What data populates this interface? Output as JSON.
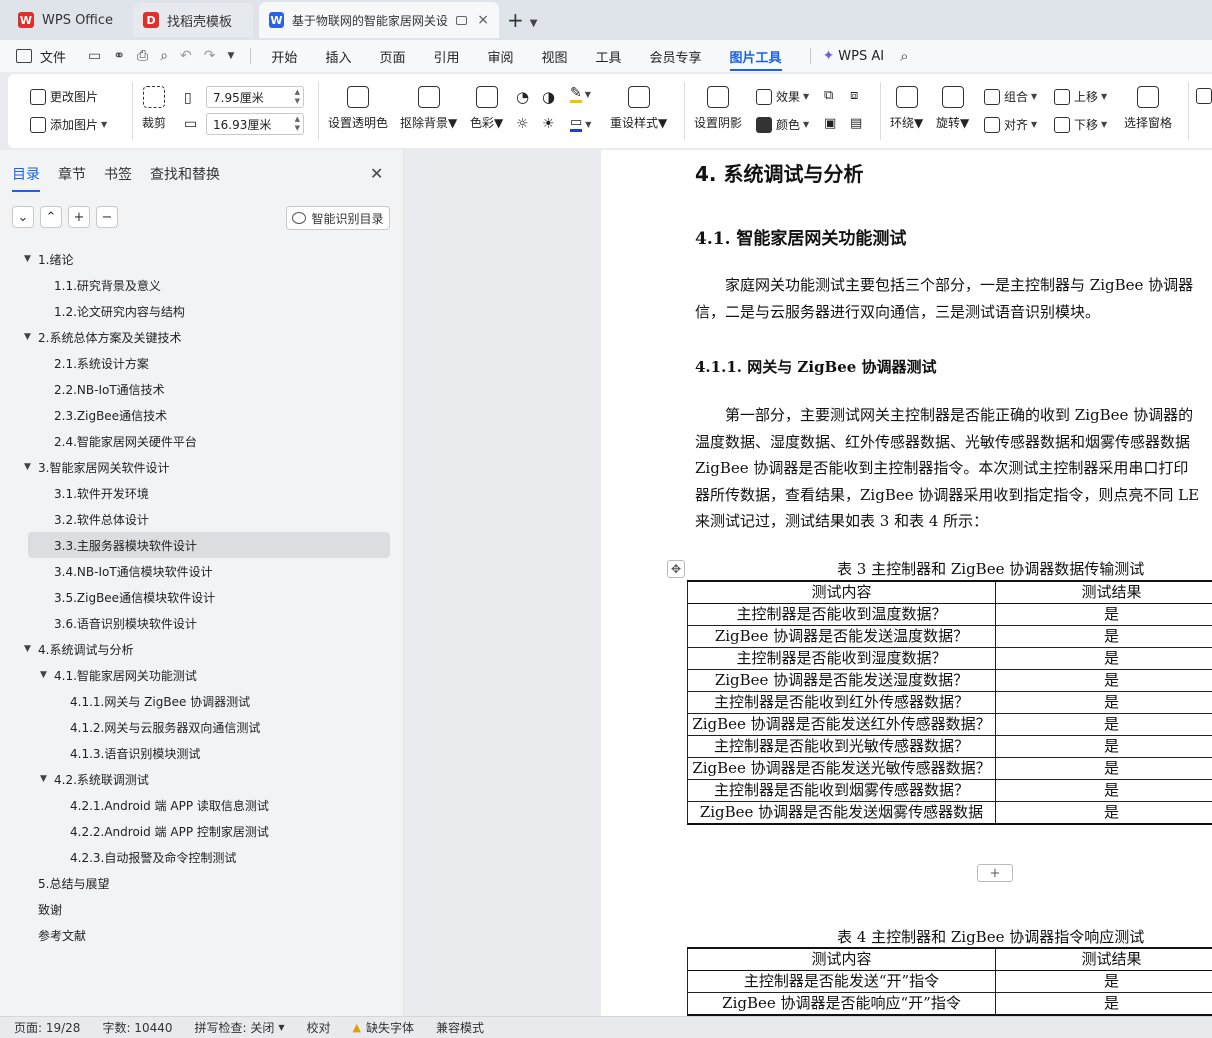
{
  "tabs": [
    {
      "label": "WPS Office",
      "icon": "wps-logo-icon",
      "color": "#e0302a"
    },
    {
      "label": "找稻壳模板",
      "icon": "docer-icon",
      "color": "#e0302a"
    },
    {
      "label": "基于物联网的智能家居网关设计",
      "icon": "writer-doc-icon",
      "color": "#2a62e8"
    }
  ],
  "menu": {
    "file": "文件",
    "items": [
      "开始",
      "插入",
      "页面",
      "引用",
      "审阅",
      "视图",
      "工具",
      "会员专享"
    ],
    "active": "图片工具",
    "ai": "WPS AI"
  },
  "ribbon": {
    "change_image": "更改图片",
    "add_image": "添加图片",
    "crop": "裁剪",
    "width": "7.95厘米",
    "height": "16.93厘米",
    "transparent": "设置透明色",
    "remove_bg": "抠除背景",
    "color": "色彩",
    "reset_style": "重设样式",
    "shadow": "设置阴影",
    "effect": "效果",
    "fill": "颜色",
    "wrap": "环绕",
    "rotate": "旋转",
    "group": "组合",
    "align": "对齐",
    "move_up": "上移",
    "move_down": "下移",
    "select_pane": "选择窗格"
  },
  "nav": {
    "tabs": [
      "目录",
      "章节",
      "书签",
      "查找和替换"
    ],
    "smart_btn": "智能识别目录",
    "toc": [
      {
        "label": "1.绪论",
        "level": 1,
        "expanded": true
      },
      {
        "label": "1.1.研究背景及意义",
        "level": 2
      },
      {
        "label": "1.2.论文研究内容与结构",
        "level": 2
      },
      {
        "label": "2.系统总体方案及关键技术",
        "level": 1,
        "expanded": true
      },
      {
        "label": "2.1.系统设计方案",
        "level": 2
      },
      {
        "label": "2.2.NB-IoT通信技术",
        "level": 2
      },
      {
        "label": "2.3.ZigBee通信技术",
        "level": 2
      },
      {
        "label": "2.4.智能家居网关硬件平台",
        "level": 2
      },
      {
        "label": "3.智能家居网关软件设计",
        "level": 1,
        "expanded": true
      },
      {
        "label": "3.1.软件开发环境",
        "level": 2
      },
      {
        "label": "3.2.软件总体设计",
        "level": 2
      },
      {
        "label": "3.3.主服务器模块软件设计",
        "level": 2,
        "selected": true
      },
      {
        "label": "3.4.NB-IoT通信模块软件设计",
        "level": 2
      },
      {
        "label": "3.5.ZigBee通信模块软件设计",
        "level": 2
      },
      {
        "label": "3.6.语音识别模块软件设计",
        "level": 2
      },
      {
        "label": "4.系统调试与分析",
        "level": 1,
        "expanded": true
      },
      {
        "label": "4.1.智能家居网关功能测试",
        "level": 2,
        "expanded": true
      },
      {
        "label": "4.1.1.网关与 ZigBee 协调器测试",
        "level": 3
      },
      {
        "label": "4.1.2.网关与云服务器双向通信测试",
        "level": 3
      },
      {
        "label": "4.1.3.语音识别模块测试",
        "level": 3
      },
      {
        "label": "4.2.系统联调测试",
        "level": 2,
        "expanded": true
      },
      {
        "label": "4.2.1.Android 端 APP 读取信息测试",
        "level": 3
      },
      {
        "label": "4.2.2.Android 端 APP 控制家居测试",
        "level": 3
      },
      {
        "label": "4.2.3.自动报警及命令控制测试",
        "level": 3
      },
      {
        "label": "5.总结与展望",
        "level": 1
      },
      {
        "label": "致谢",
        "level": 1
      },
      {
        "label": "参考文献",
        "level": 1
      }
    ]
  },
  "doc": {
    "h1": "4.  系统调试与分析",
    "h2": "4.1.  智能家居网关功能测试",
    "p1": [
      "　　家庭网关功能测试主要包括三个部分，一是主控制器与 ZigBee 协调器",
      "信，二是与云服务器进行双向通信，三是测试语音识别模块。"
    ],
    "h3": "4.1.1.  网关与 ZigBee 协调器测试",
    "p2": [
      "　　第一部分，主要测试网关主控制器是否能正确的收到 ZigBee 协调器的",
      "温度数据、湿度数据、红外传感器数据、光敏传感器数据和烟雾传感器数据",
      "ZigBee 协调器是否能收到主控制器指令。本次测试主控制器采用串口打印",
      "器所传数据，查看结果，ZigBee 协调器采用收到指定指令，则点亮不同 LE",
      "来测试记过，测试结果如表 3 和表 4 所示："
    ],
    "table3": {
      "caption": "表 3  主控制器和 ZigBee 协调器数据传输测试",
      "headers": [
        "测试内容",
        "测试结果"
      ],
      "rows": [
        [
          "主控制器是否能收到温度数据？",
          "是"
        ],
        [
          "ZigBee 协调器是否能发送温度数据？",
          "是"
        ],
        [
          "主控制器是否能收到湿度数据？",
          "是"
        ],
        [
          "ZigBee 协调器是否能发送湿度数据？",
          "是"
        ],
        [
          "主控制器是否能收到红外传感器数据？",
          "是"
        ],
        [
          "ZigBee 协调器是否能发送红外传感器数据？",
          "是"
        ],
        [
          "主控制器是否能收到光敏传感器数据？",
          "是"
        ],
        [
          "ZigBee 协调器是否能发送光敏传感器数据？",
          "是"
        ],
        [
          "主控制器是否能收到烟雾传感器数据？",
          "是"
        ],
        [
          "ZigBee 协调器是否能发送烟雾传感器数据",
          "是"
        ]
      ]
    },
    "table4": {
      "caption": "表 4  主控制器和 ZigBee 协调器指令响应测试",
      "headers": [
        "测试内容",
        "测试结果"
      ],
      "rows": [
        [
          "主控制器是否能发送“开”指令",
          "是"
        ],
        [
          "ZigBee 协调器是否能响应“开”指令",
          "是"
        ]
      ]
    }
  },
  "status": {
    "page": "页面: 19/28",
    "words": "字数: 10440",
    "spell": "拼写检查: 关闭",
    "proof": "校对",
    "missing_font": "缺失字体",
    "compat": "兼容模式"
  }
}
